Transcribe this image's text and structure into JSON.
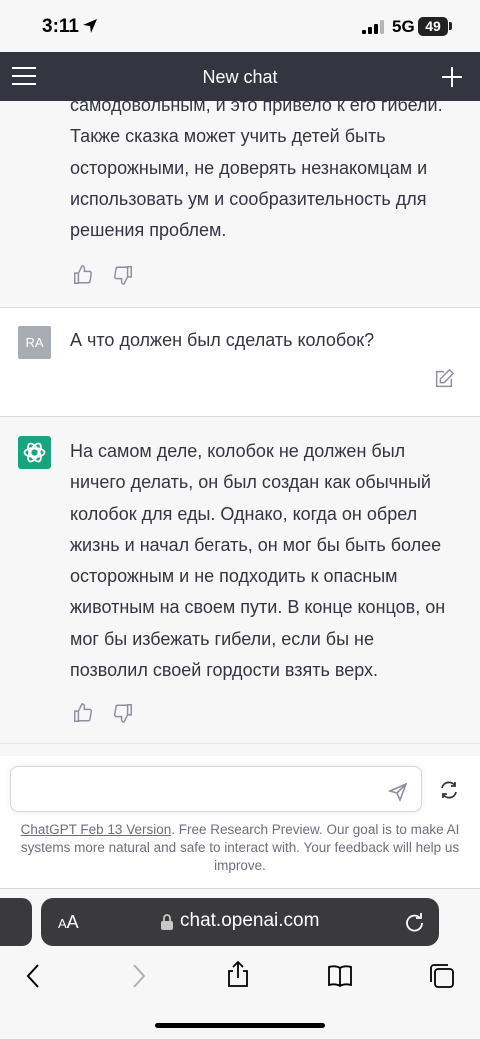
{
  "status_bar": {
    "time": "3:11",
    "network": "5G",
    "battery": "49"
  },
  "header": {
    "title": "New chat"
  },
  "messages": {
    "assistant_prev": "самодовольным, и это привело к его гибели. Также сказка может учить детей быть осторожными, не доверять незнакомцам и использовать ум и сообразительность для решения проблем.",
    "user": {
      "avatar": "RA",
      "text": "А что должен был сделать колобок?"
    },
    "assistant": "На самом деле, колобок не должен был ничего делать, он был создан как обычный колобок для еды. Однако, когда он обрел жизнь и начал бегать, он мог бы быть более осторожным и не подходить к опасным животным на своем пути. В конце концов, он мог бы избежать гибели, если бы не позволил своей гордости взять верх."
  },
  "composer": {
    "value": "",
    "placeholder": ""
  },
  "footer": {
    "version_link": "ChatGPT Feb 13 Version",
    "note": ". Free Research Preview. Our goal is to make AI systems more natural and safe to interact with. Your feedback will help us improve."
  },
  "browser": {
    "aa_small": "A",
    "aa_large": "A",
    "url": "chat.openai.com"
  },
  "colors": {
    "topbar": "#343541",
    "gpt_green": "#19a37f",
    "page_bg": "#f7f7f8"
  }
}
